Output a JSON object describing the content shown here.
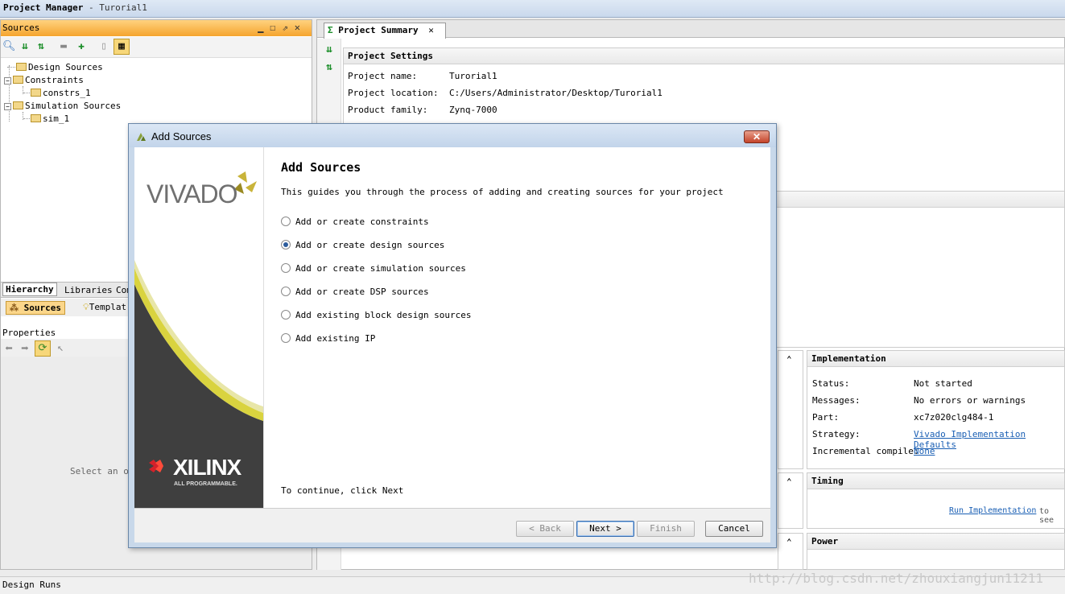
{
  "app": {
    "title": "Project Manager",
    "title_sep": "-",
    "project": "Turorial1"
  },
  "sources": {
    "title": "Sources",
    "tree": [
      {
        "label": "Design Sources"
      },
      {
        "label": "Constraints"
      },
      {
        "label": "constrs_1"
      },
      {
        "label": "Simulation Sources"
      },
      {
        "label": "sim_1"
      }
    ],
    "tabs": [
      "Hierarchy",
      "Libraries",
      "Com"
    ],
    "subtabs": [
      "Sources",
      "Templat"
    ]
  },
  "properties": {
    "title": "Properties",
    "empty_text": "Select an ob"
  },
  "summary": {
    "tab_label": "Project Summary",
    "tab_close": "✕",
    "settings": {
      "title": "Project Settings",
      "rows": [
        {
          "key": "Project name:",
          "value": "Turorial1"
        },
        {
          "key": "Project location:",
          "value": "C:/Users/Administrator/Desktop/Turorial1"
        },
        {
          "key": "Product family:",
          "value": "Zynq-7000"
        }
      ]
    },
    "implementation": {
      "title": "Implementation",
      "rows": [
        {
          "key": "Status:",
          "value": "Not started"
        },
        {
          "key": "Messages:",
          "value": "No errors or warnings"
        },
        {
          "key": "Part:",
          "value": "xc7z020clg484-1"
        },
        {
          "key": "Strategy:",
          "value": "Vivado Implementation Defaults"
        },
        {
          "key": "Incremental compile:",
          "value": "None"
        }
      ]
    },
    "timing": {
      "title": "Timing",
      "link": "Run Implementation",
      "suffix": "to see"
    },
    "power": {
      "title": "Power"
    }
  },
  "dialog": {
    "title": "Add Sources",
    "close": "✕",
    "heading": "Add Sources",
    "description": "This guides you through the process of adding and creating sources for your project",
    "options": [
      {
        "label": "Add or create constraints",
        "checked": false
      },
      {
        "label": "Add or create design sources",
        "checked": true
      },
      {
        "label": "Add or create simulation sources",
        "checked": false
      },
      {
        "label": "Add or create DSP sources",
        "checked": false
      },
      {
        "label": "Add existing block design sources",
        "checked": false
      },
      {
        "label": "Add existing IP",
        "checked": false
      }
    ],
    "continue_text": "To continue, click Next",
    "buttons": {
      "back": "< Back",
      "next": "Next >",
      "finish": "Finish",
      "cancel": "Cancel"
    },
    "brand": {
      "vivado": "VIVADO",
      "xilinx": "XILINX",
      "tagline": "ALL PROGRAMMABLE."
    }
  },
  "status_bar": {
    "label": "Design Runs"
  },
  "watermark": "http://blog.csdn.net/zhouxiangjun11211",
  "colors": {
    "accent_orange": "#f5a42e",
    "link_blue": "#1a5fb4",
    "xilinx_red": "#d4212a",
    "vivado_gold": "#c9b43a"
  }
}
